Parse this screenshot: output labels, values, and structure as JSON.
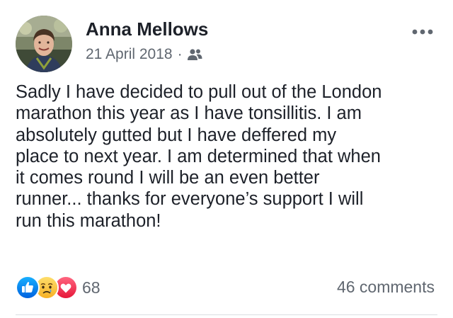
{
  "post": {
    "author_name": "Anna Mellows",
    "date": "21 April 2018",
    "separator": "·",
    "audience_icon": "friends-icon",
    "more_icon": "more-options-icon",
    "text_lines": [
      "Sadly I have decided to pull out of the London",
      "marathon this year as I have tonsillitis. I am",
      "absolutely gutted but I have deffered my",
      "place to next year. I am determined that when",
      "it comes round I will be an even better",
      "runner... thanks for everyone’s support I will",
      "run this marathon!"
    ]
  },
  "footer": {
    "reactions": [
      "like-reaction-icon",
      "sad-reaction-icon",
      "love-reaction-icon"
    ],
    "reaction_count": "68",
    "comments_label": "46 comments"
  },
  "colors": {
    "text": "#1d2129",
    "secondary": "#606770",
    "like_blue": "#1877f2",
    "love_red": "#f33e58",
    "sad_yellow": "#f7b125",
    "divider": "#dadde1"
  }
}
